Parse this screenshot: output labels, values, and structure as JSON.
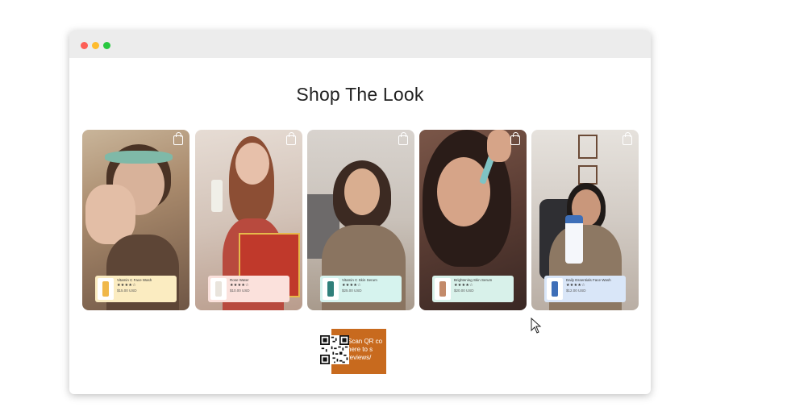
{
  "window": {
    "controls": [
      "close",
      "minimize",
      "maximize"
    ]
  },
  "page": {
    "title": "Shop The Look"
  },
  "cards": [
    {
      "product": {
        "name": "Vitamin C Face Wash",
        "rating": "★★★★☆",
        "price": "$15.00 USD"
      },
      "icon": "shopping-bag-icon"
    },
    {
      "product": {
        "name": "Rose Water",
        "rating": "★★★★☆",
        "price": "$10.00 USD"
      },
      "icon": "shopping-bag-icon"
    },
    {
      "product": {
        "name": "Vitamin C Skin Serum",
        "rating": "★★★★☆",
        "price": "$25.00 USD"
      },
      "icon": "shopping-bag-icon"
    },
    {
      "product": {
        "name": "Brightening Skin Serum",
        "rating": "★★★★☆",
        "price": "$20.00 USD"
      },
      "icon": "shopping-bag-icon"
    },
    {
      "product": {
        "name": "Daily Essentials Face Wash",
        "rating": "★★★★☆",
        "price": "$12.00 USD"
      },
      "icon": "shopping-bag-icon"
    }
  ],
  "qr": {
    "line1": "Scan QR co",
    "line2": "here to s",
    "line3": "reviews/"
  },
  "colors": {
    "accent": "#c86a1e"
  }
}
